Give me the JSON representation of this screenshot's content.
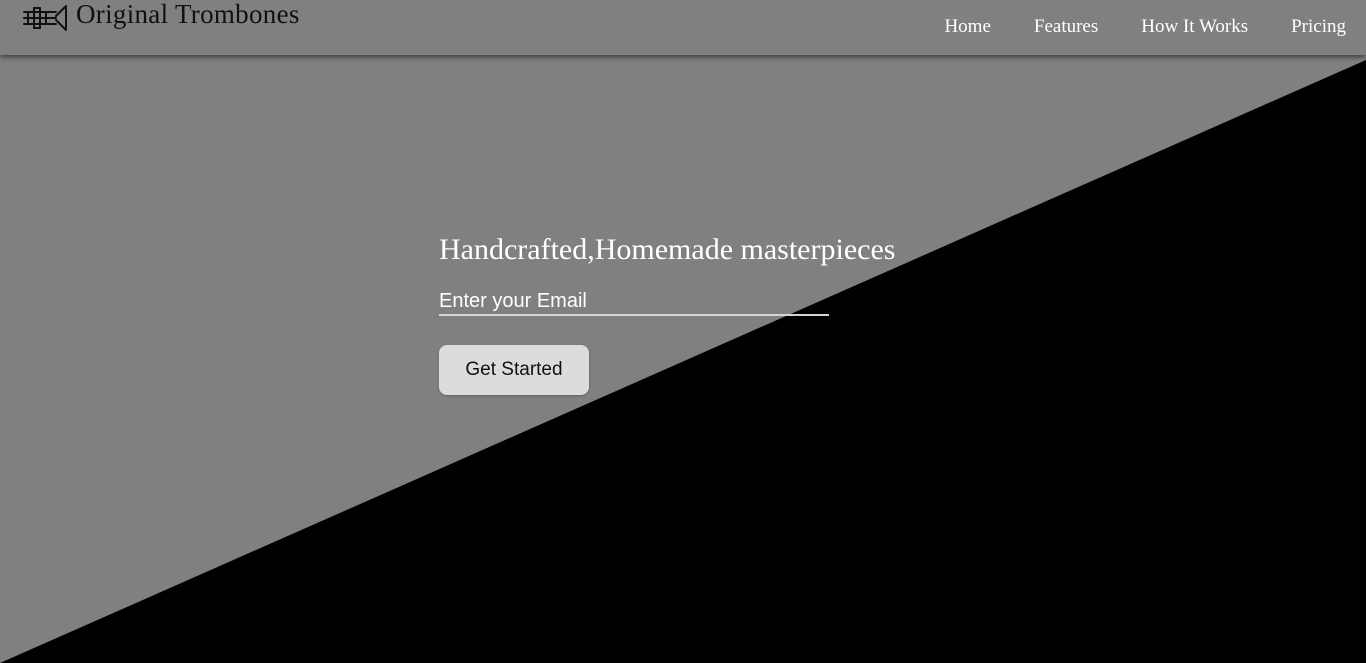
{
  "brand": {
    "name": "Original Trombones",
    "icon": "trombone-logo-icon"
  },
  "nav": {
    "items": [
      {
        "label": "Home"
      },
      {
        "label": "Features"
      },
      {
        "label": "How It Works"
      },
      {
        "label": "Pricing"
      }
    ]
  },
  "hero": {
    "title": "Handcrafted,Homemade masterpieces",
    "email_placeholder": "Enter your Email",
    "email_value": "",
    "cta_label": "Get Started"
  },
  "colors": {
    "background_gray": "#808080",
    "diagonal_black": "#000000",
    "nav_text": "#ffffff",
    "button_bg": "#dcdcdc"
  }
}
